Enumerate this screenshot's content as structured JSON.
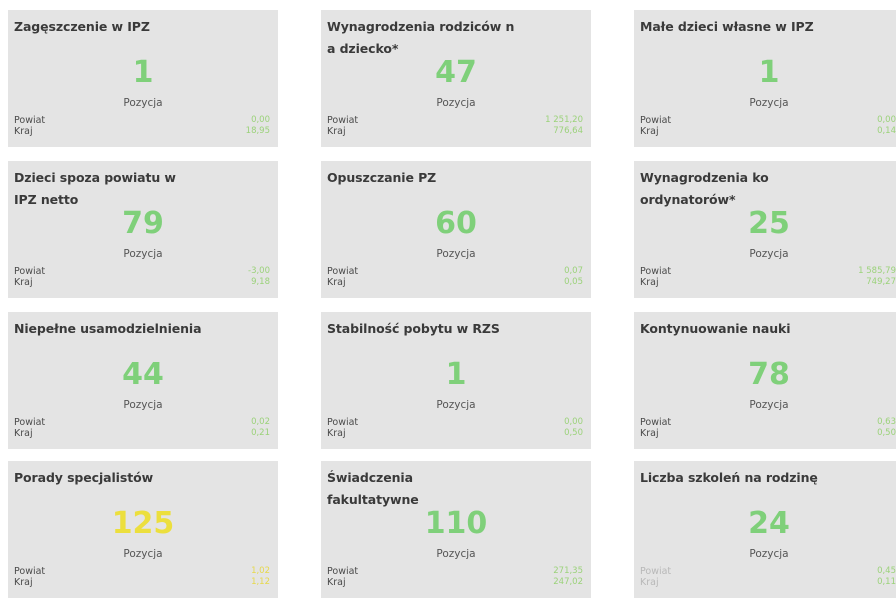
{
  "caption": "Pozycja",
  "colors": {
    "tile_bg": "#e4e4e4",
    "value_green": "#7fd07a",
    "value_yellow": "#ecdf3d",
    "number_green": "#9bd27a",
    "number_yellow": "#e6d84a"
  },
  "cards": [
    {
      "title": "Zagęszczenie w IPZ",
      "value": "1",
      "tone": "green",
      "powiat_label": "Powiat",
      "powiat": "0,00",
      "kraj_label": "Kraj",
      "kraj": "18,95"
    },
    {
      "title": "Wynagrodzenia rodziców na dziecko*",
      "value": "47",
      "tone": "green",
      "powiat_label": "Powiat",
      "powiat": "1 251,20",
      "kraj_label": "Kraj",
      "kraj": "776,64"
    },
    {
      "title": "Małe dzieci własne w IPZ",
      "value": "1",
      "tone": "green",
      "powiat_label": "Powiat",
      "powiat": "0,00",
      "kraj_label": "Kraj",
      "kraj": "0,14"
    },
    {
      "title": "Dzieci spoza powiatu w IPZ netto",
      "value": "79",
      "tone": "green",
      "powiat_label": "Powiat",
      "powiat": "-3,00",
      "kraj_label": "Kraj",
      "kraj": "9,18"
    },
    {
      "title": "Opuszczanie PZ",
      "value": "60",
      "tone": "green",
      "powiat_label": "Powiat",
      "powiat": "0,07",
      "kraj_label": "Kraj",
      "kraj": "0,05"
    },
    {
      "title": "Wynagrodzenia koordynatorów*",
      "value": "25",
      "tone": "green",
      "powiat_label": "Powiat",
      "powiat": "1 585,79",
      "kraj_label": "Kraj",
      "kraj": "749,27"
    },
    {
      "title": "Niepełne usamodzielnienia",
      "value": "44",
      "tone": "green",
      "powiat_label": "Powiat",
      "powiat": "0,02",
      "kraj_label": "Kraj",
      "kraj": "0,21"
    },
    {
      "title": "Stabilność pobytu w RZS",
      "value": "1",
      "tone": "green",
      "powiat_label": "Powiat",
      "powiat": "0,00",
      "kraj_label": "Kraj",
      "kraj": "0,50"
    },
    {
      "title": "Kontynuowanie nauki",
      "value": "78",
      "tone": "green",
      "powiat_label": "Powiat",
      "powiat": "0,63",
      "kraj_label": "Kraj",
      "kraj": "0,50"
    },
    {
      "title": "Porady specjalistów",
      "value": "125",
      "tone": "yellow",
      "powiat_label": "Powiat",
      "powiat": "1,02",
      "kraj_label": "Kraj",
      "kraj": "1,12"
    },
    {
      "title": "Świadczenia fakultatywne",
      "value": "110",
      "tone": "green",
      "powiat_label": "Powiat",
      "powiat": "271,35",
      "kraj_label": "Kraj",
      "kraj": "247,02"
    },
    {
      "title": "Liczba szkoleń na rodzinę",
      "value": "24",
      "tone": "green",
      "powiat_label": "Powiat",
      "powiat": "0,45",
      "kraj_label": "Kraj",
      "kraj": "0,11",
      "labels_faded": true
    }
  ]
}
